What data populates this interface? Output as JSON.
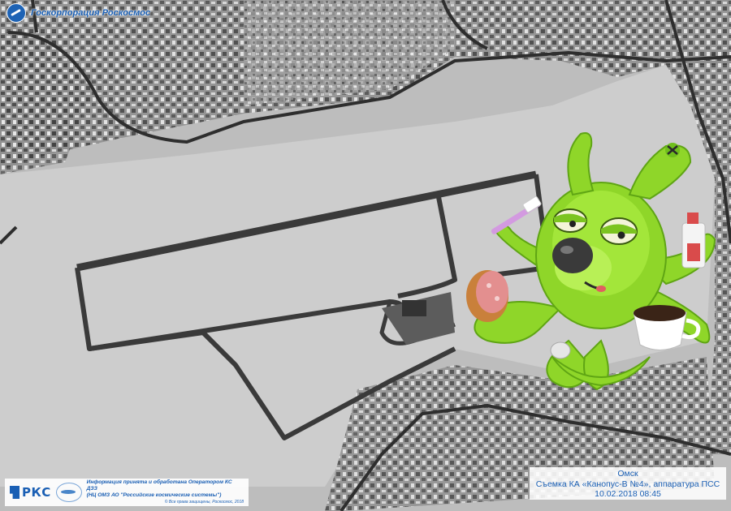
{
  "header": {
    "org_name": "Госкорпорация Роскосмос",
    "icon": "roscosmos-emblem-icon"
  },
  "footer": {
    "rks_logo_text": "РКС",
    "info_line1": "Информация принята и обработана Оператором КС ДЗЗ",
    "info_line2": "(НЦ ОМЗ АО \"Российские космические системы\")",
    "copyright": "© Все права защищены, Роскосмос, 2018"
  },
  "caption": {
    "city": "Омск",
    "survey": "Съемка КА «Канопус-В №4», аппаратура ПСС",
    "datetime": "10.02.2018  08:45"
  },
  "colors": {
    "caption_text": "#1a5fb4",
    "snow": "#c4c4c4",
    "runway": "#3a3a3a",
    "mascot_green": "#8fd629"
  }
}
